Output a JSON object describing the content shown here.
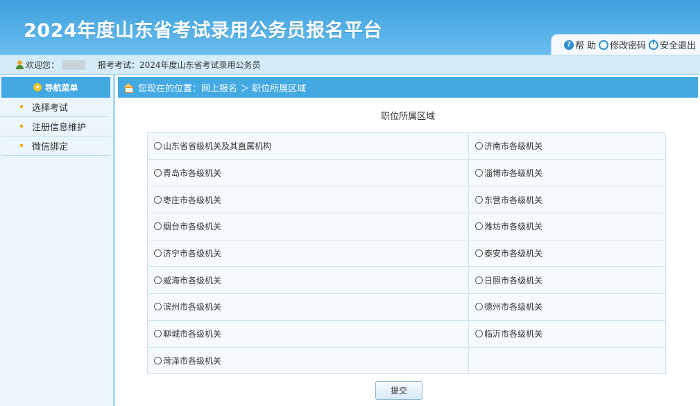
{
  "header": {
    "title": "2024年度山东省考试录用公务员报名平台",
    "help_label": "帮 助",
    "change_password_label": "修改密码",
    "logout_label": "安全退出"
  },
  "infobar": {
    "welcome_label": "欢迎您：",
    "exam_label": "报考考试：2024年度山东省考试录用公务员"
  },
  "sidebar": {
    "title": "导航菜单",
    "items": [
      {
        "label": "选择考试"
      },
      {
        "label": "注册信息维护"
      },
      {
        "label": "微信绑定"
      }
    ]
  },
  "breadcrumb": "您现在的位置：网上报名 ＞ 职位所属区域",
  "section_title": "职位所属区域",
  "regions": [
    [
      "山东省省级机关及其直属机构",
      "济南市各级机关"
    ],
    [
      "青岛市各级机关",
      "淄博市各级机关"
    ],
    [
      "枣庄市各级机关",
      "东营市各级机关"
    ],
    [
      "烟台市各级机关",
      "潍坊市各级机关"
    ],
    [
      "济宁市各级机关",
      "泰安市各级机关"
    ],
    [
      "威海市各级机关",
      "日照市各级机关"
    ],
    [
      "滨州市各级机关",
      "德州市各级机关"
    ],
    [
      "聊城市各级机关",
      "临沂市各级机关"
    ],
    [
      "菏泽市各级机关",
      ""
    ]
  ],
  "submit_label": "提交",
  "colors": {
    "header_blue": "#4aa8e2",
    "nav_blue": "#42a9e3",
    "infobar_bg": "#d4ecf9"
  }
}
